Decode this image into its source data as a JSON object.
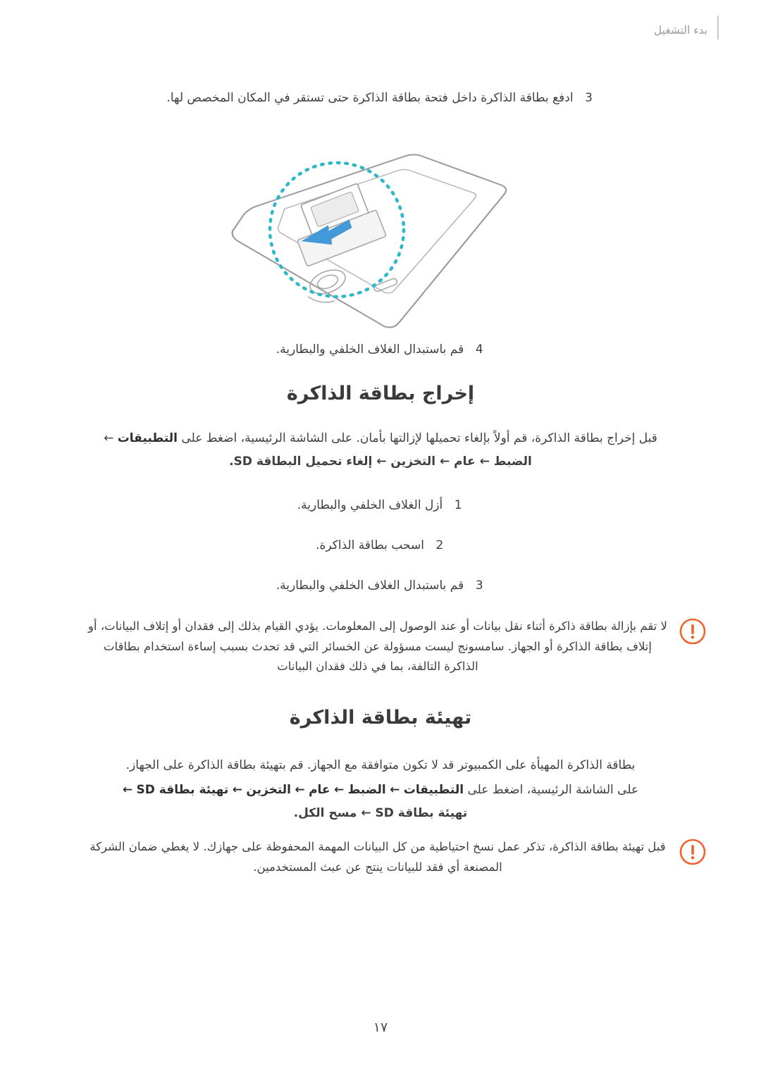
{
  "header": {
    "chapter": "بدء التشغيل"
  },
  "steps_top": [
    {
      "num": "3",
      "text": "ادفع بطاقة الذاكرة داخل فتحة بطاقة الذاكرة حتى تستقر في المكان المخصص لها."
    },
    {
      "num": "4",
      "text": "قم باستبدال الغلاف الخلفي والبطارية."
    }
  ],
  "section_eject": {
    "title": "إخراج بطاقة الذاكرة",
    "intro_line1": "قبل إخراج بطاقة الذاكرة، قم أولاً بإلغاء تحميلها لإزالتها بأمان. على الشاشة الرئيسية، اضغط على",
    "intro_bold1": "التطبيقات",
    "intro_arrow": "←",
    "intro_line2_parts": [
      "الضبط",
      "عام",
      "التخزين",
      "إلغاء تحميل البطاقة SD."
    ],
    "steps": [
      {
        "num": "1",
        "text": "أزل الغلاف الخلفي والبطارية."
      },
      {
        "num": "2",
        "text": "اسحب بطاقة الذاكرة."
      },
      {
        "num": "3",
        "text": "قم باستبدال الغلاف الخلفي والبطارية."
      }
    ],
    "caution": "لا تقم بإزالة بطاقة ذاكرة أثناء نقل بيانات أو عند الوصول إلى المعلومات. يؤدي القيام بذلك إلى فقدان أو إتلاف البيانات، أو إتلاف بطاقة الذاكرة أو الجهاز. سامسونج ليست مسؤولة عن الخسائر التي قد تحدث بسبب إساءة استخدام بطاقات الذاكرة التالفة، بما في ذلك فقدان البيانات"
  },
  "section_format": {
    "title": "تهيئة بطاقة الذاكرة",
    "intro": "بطاقة الذاكرة المهيأة على الكمبيوتر قد لا تكون متوافقة مع الجهاز. قم بتهيئة بطاقة الذاكرة على الجهاز.",
    "path_line_prefix": "على الشاشة الرئيسية، اضغط على",
    "path_parts": [
      "التطبيقات",
      "الضبط",
      "عام",
      "التخزين",
      "تهيئة بطاقة SD",
      "تهيئة بطاقة SD",
      "مسح الكل."
    ],
    "arrow": "←",
    "caution": "قبل تهيئة بطاقة الذاكرة، تذكر عمل نسخ احتياطية من كل البيانات المهمة المحفوظة على جهازك. لا يغطي ضمان الشركة المصنعة أي فقد للبيانات ينتج عن عبث المستخدمين."
  },
  "footer": {
    "page_number": "١٧"
  },
  "colors": {
    "caution_icon": "#F2622E",
    "illustration_circle": "#2BB9C8",
    "illustration_arrow": "#3A95D6",
    "device_outline": "#8a8a8a"
  },
  "illustration": {
    "alt": "رسم توضيحي لإدخال بطاقة الذاكرة في فتحة البطاقة بالجهاز"
  }
}
